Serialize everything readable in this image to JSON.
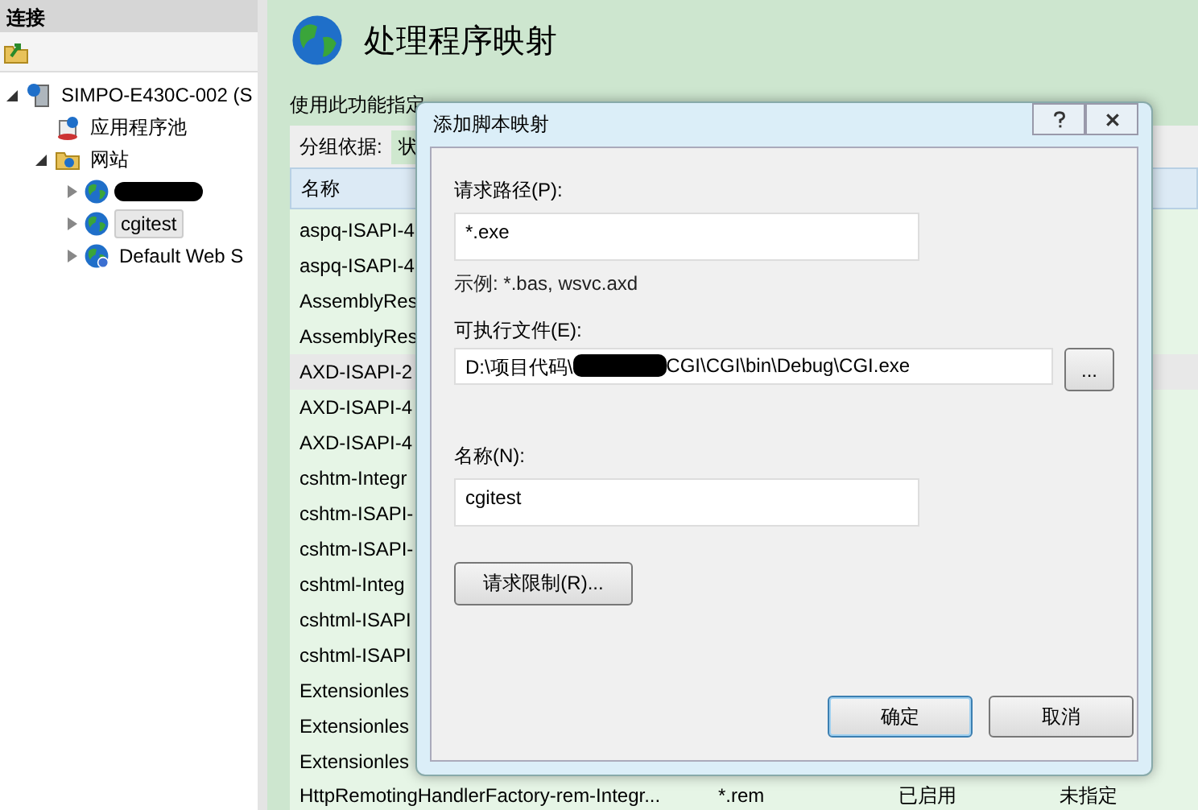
{
  "connections": {
    "title": "连接",
    "tree": [
      {
        "label": "SIMPO-E430C-002 (S",
        "kind": "server",
        "expanded": true,
        "children": [
          {
            "label": "应用程序池",
            "kind": "pool"
          },
          {
            "label": "网站",
            "kind": "folder",
            "expanded": true,
            "children": [
              {
                "kind": "redacted-site",
                "expanded": false,
                "selected": false
              },
              {
                "label": "cgitest",
                "kind": "site",
                "expanded": false,
                "selected": true
              },
              {
                "label": "Default Web S",
                "kind": "default-site",
                "expanded": false,
                "selected": false
              }
            ]
          }
        ]
      }
    ]
  },
  "feature": {
    "title": "处理程序映射",
    "description": "使用此功能指定",
    "group_by_label": "分组依据:",
    "group_by_value": "状",
    "columns": [
      "名称"
    ],
    "rows": [
      {
        "cells": [
          "aspq-ISAPI-4"
        ],
        "selected": false
      },
      {
        "cells": [
          "aspq-ISAPI-4"
        ],
        "selected": false
      },
      {
        "cells": [
          "AssemblyRes"
        ],
        "selected": false
      },
      {
        "cells": [
          "AssemblyRes"
        ],
        "selected": false
      },
      {
        "cells": [
          "AXD-ISAPI-2"
        ],
        "selected": true
      },
      {
        "cells": [
          "AXD-ISAPI-4"
        ],
        "selected": false
      },
      {
        "cells": [
          "AXD-ISAPI-4"
        ],
        "selected": false
      },
      {
        "cells": [
          "cshtm-Integr"
        ],
        "selected": false
      },
      {
        "cells": [
          "cshtm-ISAPI-"
        ],
        "selected": false
      },
      {
        "cells": [
          "cshtm-ISAPI-"
        ],
        "selected": false
      },
      {
        "cells": [
          "cshtml-Integ"
        ],
        "selected": false
      },
      {
        "cells": [
          "cshtml-ISAPI"
        ],
        "selected": false
      },
      {
        "cells": [
          "cshtml-ISAPI"
        ],
        "selected": false
      },
      {
        "cells": [
          "Extensionles"
        ],
        "selected": false
      },
      {
        "cells": [
          "Extensionles"
        ],
        "selected": false
      },
      {
        "cells": [
          "Extensionles"
        ],
        "selected": false
      },
      {
        "cells": [
          "HttpRemotingHandlerFactory-rem-Integr...",
          "*.rem",
          "已启用",
          "未指定"
        ],
        "selected": false
      }
    ]
  },
  "dialog": {
    "title": "添加脚本映射",
    "request_path": {
      "label": "请求路径(P):",
      "value": "*.exe"
    },
    "example": "示例: *.bas, wsvc.axd",
    "executable": {
      "label": "可执行文件(E):",
      "value_start": "D:\\项目代码\\",
      "value_end": "CGI\\CGI\\bin\\Debug\\CGI.exe",
      "browse": "..."
    },
    "name": {
      "label": "名称(N):",
      "value": "cgitest"
    },
    "restrictions_button": "请求限制(R)...",
    "buttons": [
      {
        "label": "确定",
        "default": true
      },
      {
        "label": "取消",
        "default": false
      }
    ]
  }
}
